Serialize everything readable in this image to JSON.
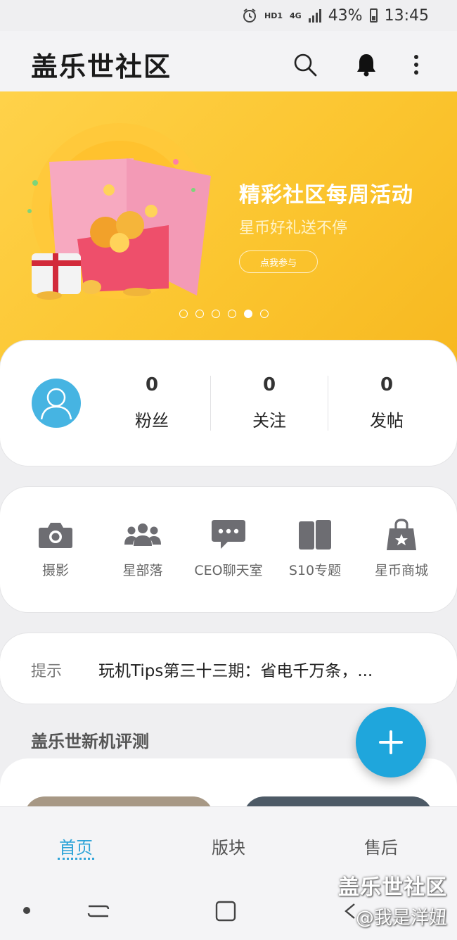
{
  "status_bar": {
    "hd": "HD1",
    "network": "4G",
    "battery": "43%",
    "time": "13:45"
  },
  "app": {
    "title": "盖乐世社区"
  },
  "banner": {
    "title": "精彩社区每周活动",
    "subtitle": "星币好礼送不停",
    "button": "点我参与",
    "slides_total": 6,
    "active_slide": 5
  },
  "profile": {
    "stats": [
      {
        "value": "0",
        "label": "粉丝"
      },
      {
        "value": "0",
        "label": "关注"
      },
      {
        "value": "0",
        "label": "发帖"
      }
    ]
  },
  "shortcuts": [
    {
      "label": "摄影",
      "icon": "camera-icon"
    },
    {
      "label": "星部落",
      "icon": "group-icon"
    },
    {
      "label": "CEO聊天室",
      "icon": "chat-icon"
    },
    {
      "label": "S10专题",
      "icon": "phone-icon"
    },
    {
      "label": "星币商城",
      "icon": "shopping-bag-icon"
    }
  ],
  "tips": {
    "tag": "提示",
    "text": "玩机Tips第三十三期：省电千万条，..."
  },
  "section": {
    "title": "盖乐世新机评测"
  },
  "bottom_nav": {
    "tabs": [
      {
        "label": "首页",
        "active": true
      },
      {
        "label": "版块",
        "active": false
      },
      {
        "label": "售后",
        "active": false
      }
    ]
  },
  "watermark": {
    "line1": "盖乐世社区",
    "line2": "@我是洋妞"
  },
  "colors": {
    "accent": "#1fa6dc",
    "banner": "#fbc52f",
    "avatar": "#46b4e2"
  }
}
